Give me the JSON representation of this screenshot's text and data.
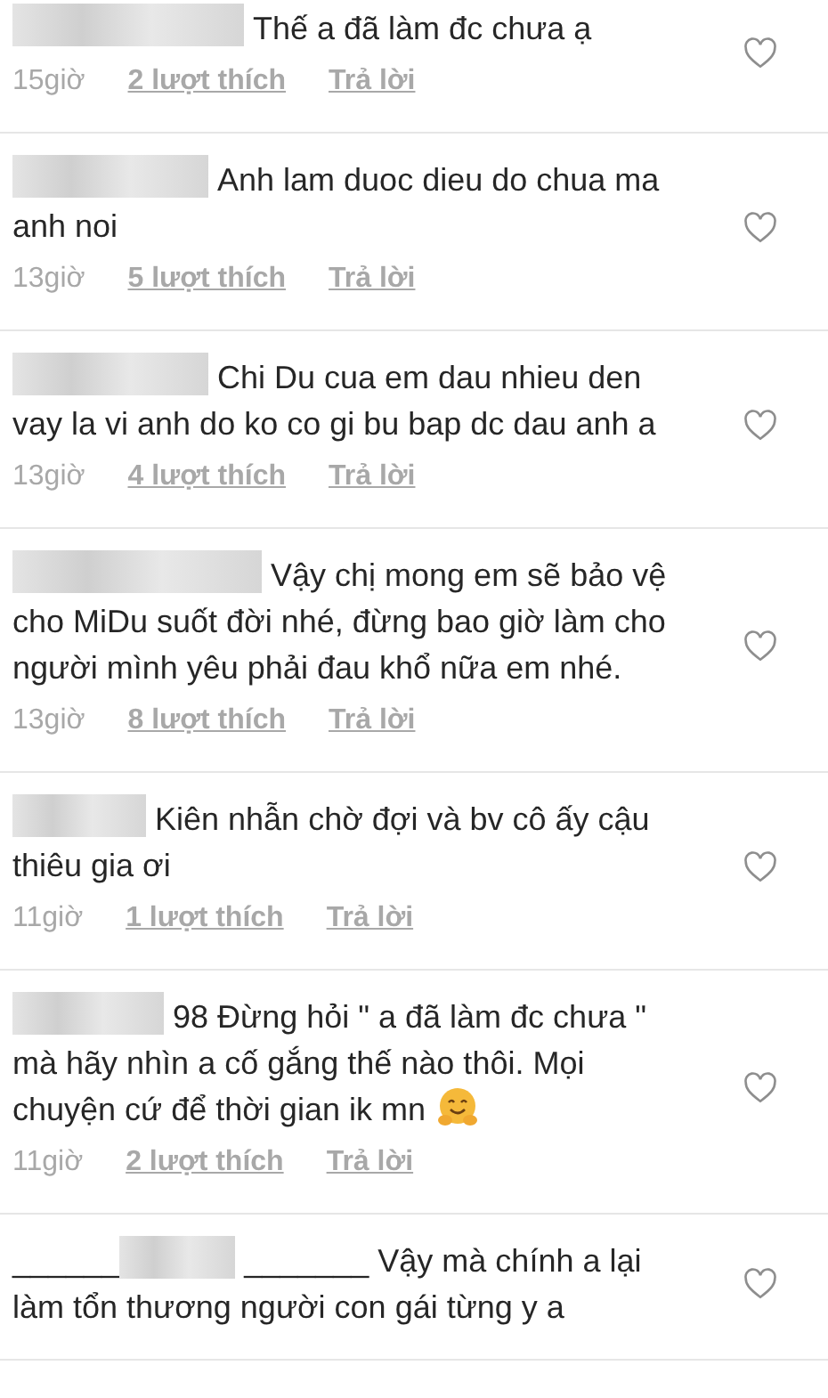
{
  "comments": [
    {
      "text": "Thế a đã làm đc chưa ạ",
      "time": "15giờ",
      "likes": "2 lượt thích",
      "reply": "Trả lời",
      "liked": false
    },
    {
      "text": "Anh lam duoc dieu do chua ma anh noi",
      "time": "13giờ",
      "likes": "5 lượt thích",
      "reply": "Trả lời",
      "liked": false
    },
    {
      "text": "Chi Du cua em dau nhieu den vay la vi anh do ko co gi bu bap dc dau anh a",
      "time": "13giờ",
      "likes": "4 lượt thích",
      "reply": "Trả lời",
      "liked": false
    },
    {
      "text": "Vậy chị mong em sẽ bảo vệ cho MiDu suốt đời nhé, đừng bao giờ làm cho người mình yêu phải đau khổ nữa em nhé.",
      "time": "13giờ",
      "likes": "8 lượt thích",
      "reply": "Trả lời",
      "liked": false
    },
    {
      "text": "Kiên nhẫn chờ đợi và bv cô ấy cậu thiêu gia ơi",
      "time": "11giờ",
      "likes": "1 lượt thích",
      "reply": "Trả lời",
      "liked": false
    },
    {
      "text": "98 Đừng hỏi \" a đã làm đc chưa \" mà hãy nhìn a cố gắng thế nào thôi. Mọi chuyện cứ để thời gian ik mn",
      "time": "11giờ",
      "likes": "2 lượt thích",
      "reply": "Trả lời",
      "liked": false,
      "emoji": true
    },
    {
      "username_prefix": "______",
      "text": "_______ Vậy mà chính a lại làm tổn thương người con gái từng y a",
      "liked": false
    }
  ]
}
